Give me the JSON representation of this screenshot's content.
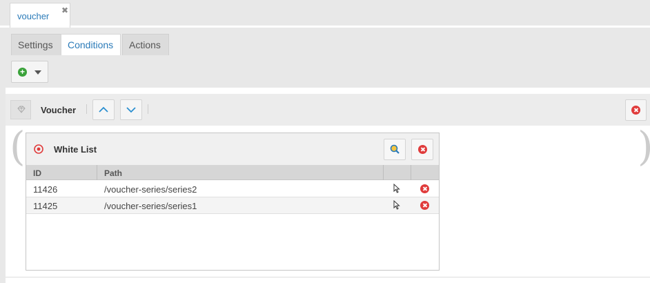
{
  "document_tab": {
    "label": "voucher",
    "close_icon": "close-icon"
  },
  "subtabs": [
    {
      "label": "Settings",
      "active": false
    },
    {
      "label": "Conditions",
      "active": true
    },
    {
      "label": "Actions",
      "active": false
    }
  ],
  "toolbar": {
    "add_icon": "plus-circle-icon",
    "dropdown_icon": "caret-down-icon"
  },
  "condition": {
    "title": "Voucher",
    "icon": "diamond-icon",
    "move_up_icon": "chevron-up-icon",
    "move_down_icon": "chevron-down-icon",
    "remove_icon": "remove-circle-icon"
  },
  "whitelist": {
    "title": "White List",
    "icon": "target-icon",
    "search_icon": "search-icon",
    "remove_icon": "remove-circle-icon",
    "columns": {
      "id": "ID",
      "path": "Path"
    },
    "rows": [
      {
        "id": "11426",
        "path": "/voucher-series/series2"
      },
      {
        "id": "11425",
        "path": "/voucher-series/series1"
      }
    ]
  },
  "colors": {
    "accent": "#2a7ab8",
    "add_green": "#3aa23a",
    "remove_red": "#e03b3b"
  }
}
